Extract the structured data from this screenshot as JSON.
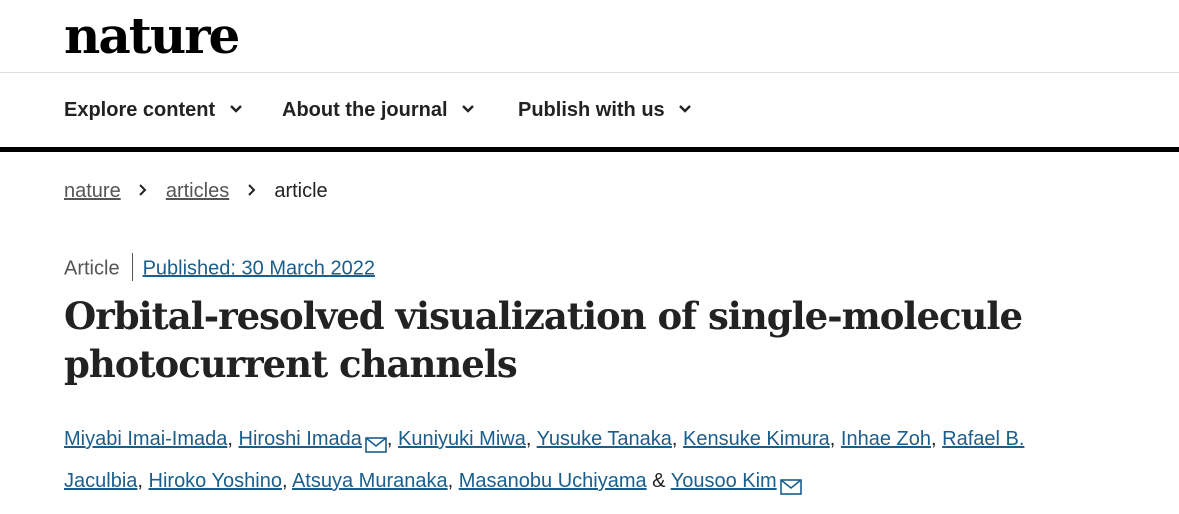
{
  "site": {
    "logo": "nature"
  },
  "nav": {
    "items": [
      {
        "label": "Explore content"
      },
      {
        "label": "About the journal"
      },
      {
        "label": "Publish with us"
      }
    ]
  },
  "breadcrumb": {
    "items": [
      "nature",
      "articles",
      "article"
    ]
  },
  "article": {
    "type": "Article",
    "published": "Published: 30 March 2022",
    "title": "Orbital-resolved visualization of single-molecule photocurrent channels",
    "authors": [
      "Miyabi Imai-Imada",
      "Hiroshi Imada",
      "Kuniyuki Miwa",
      "Yusuke Tanaka",
      "Kensuke Kimura",
      "Inhae Zoh",
      "Rafael B. Jaculbia",
      "Hiroko Yoshino",
      "Atsuya Muranaka",
      "Masanobu Uchiyama",
      "Yousoo Kim"
    ],
    "separator": ", ",
    "last_separator": " & "
  },
  "colors": {
    "link": "#1a5e8c",
    "text": "#222222",
    "rule": "#000000"
  },
  "icons": {
    "nav_chevron": "chevron-down-icon",
    "breadcrumb_sep": "chevron-right-icon",
    "corresponding": "mail-icon"
  }
}
